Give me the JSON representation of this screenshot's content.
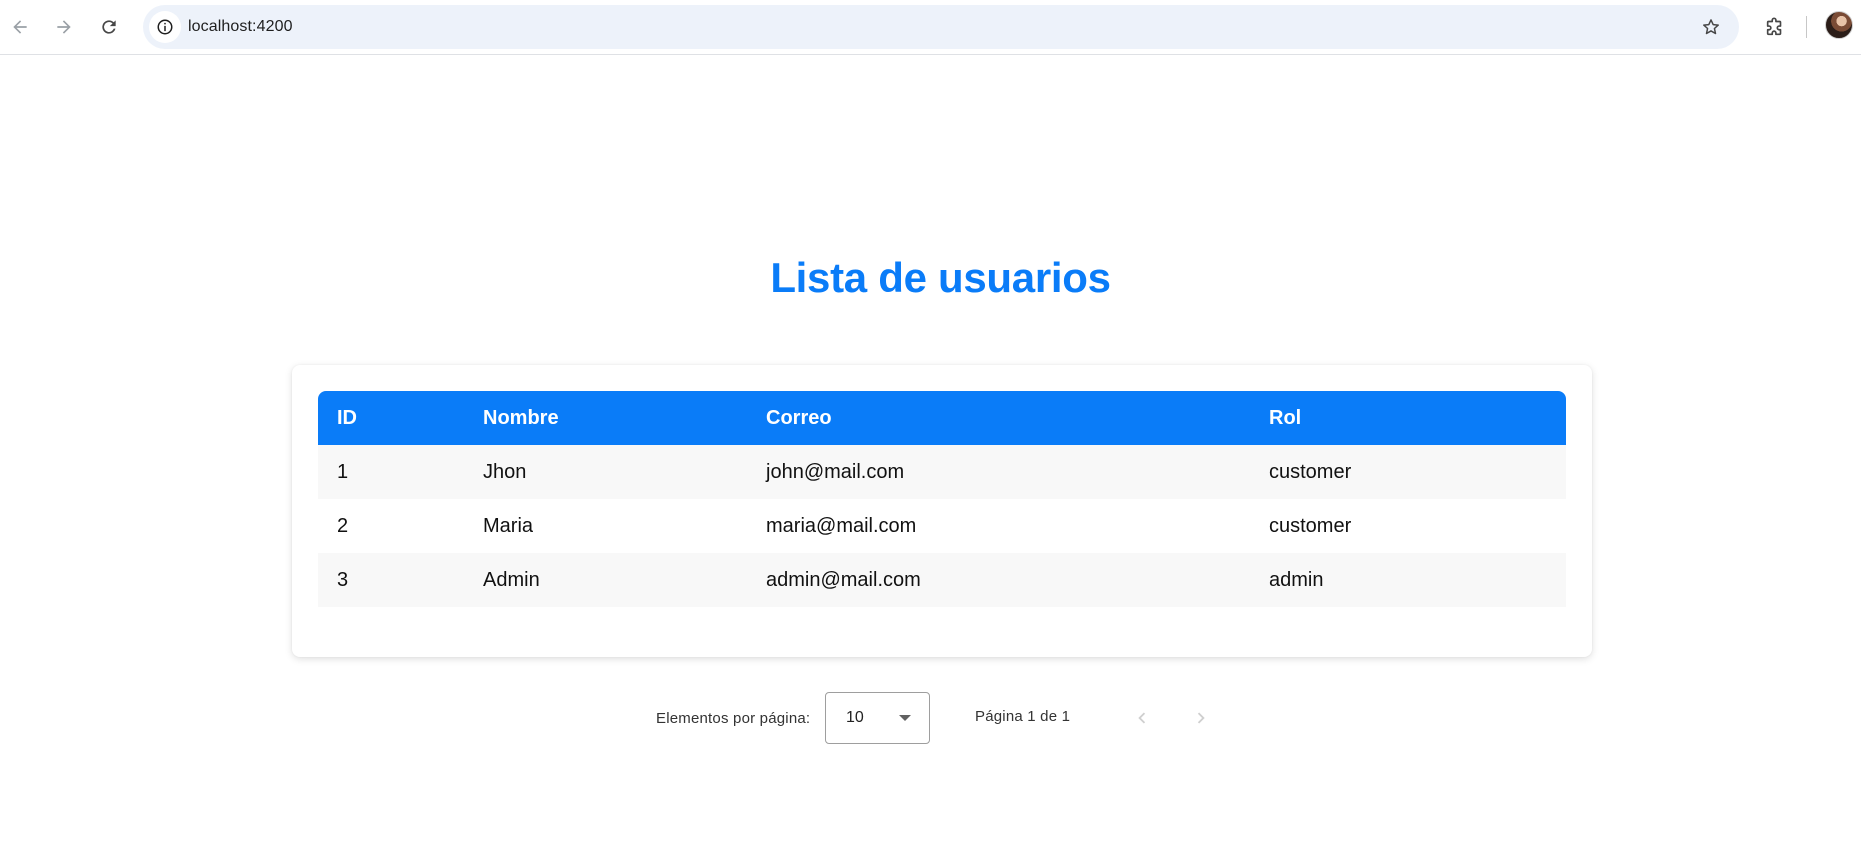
{
  "browser": {
    "url": "localhost:4200",
    "icons": {
      "back": "arrow-left-icon",
      "forward": "arrow-right-icon",
      "reload": "reload-icon",
      "site_info": "info-icon",
      "bookmark": "star-icon",
      "extensions": "puzzle-icon"
    }
  },
  "page": {
    "title": "Lista de usuarios"
  },
  "table": {
    "columns": [
      "ID",
      "Nombre",
      "Correo",
      "Rol"
    ],
    "rows": [
      [
        "1",
        "Jhon",
        "john@mail.com",
        "customer"
      ],
      [
        "2",
        "Maria",
        "maria@mail.com",
        "customer"
      ],
      [
        "3",
        "Admin",
        "admin@mail.com",
        "admin"
      ]
    ]
  },
  "paginator": {
    "page_size_label": "Elementos por página:",
    "page_size_value": "10",
    "range_label": "Página 1 de 1",
    "prev_enabled": false,
    "next_enabled": false
  },
  "colors": {
    "accent": "#0a7cf8",
    "row_stripe": "#f8f8f8",
    "omnibox_bg": "#edf2fa"
  }
}
